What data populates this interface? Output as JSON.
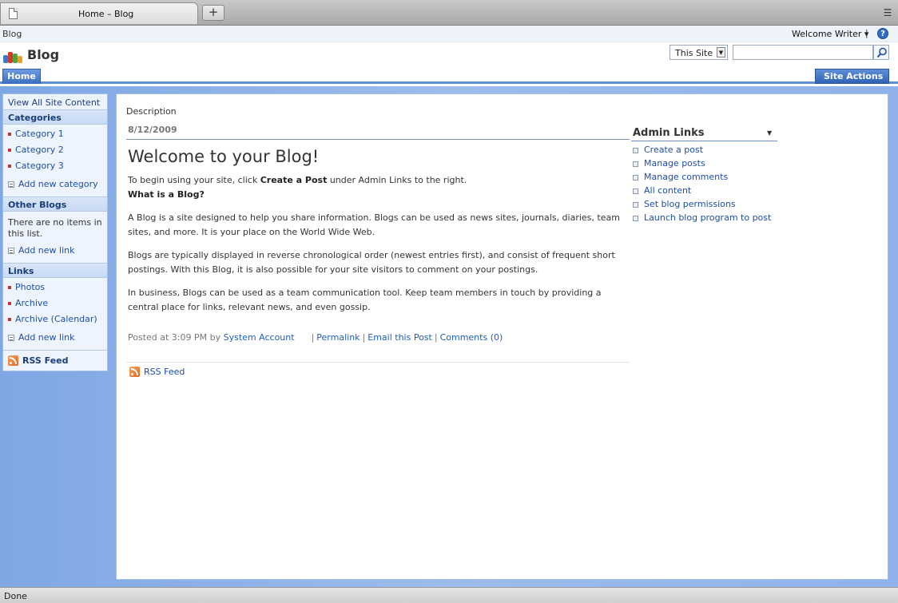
{
  "browser": {
    "tab_title": "Home – Blog",
    "new_tab": "+",
    "status": "Done"
  },
  "global": {
    "site_name": "Blog",
    "welcome": "Welcome Writer ▾",
    "welcome_sep": "|",
    "help": "?"
  },
  "header": {
    "title": "Blog",
    "scope_value": "This Site",
    "search_value": ""
  },
  "nav": {
    "home": "Home",
    "site_actions": "Site Actions ▾"
  },
  "leftnav": {
    "view_all": "View All Site Content",
    "categories_head": "Categories",
    "categories": [
      "Category 1",
      "Category 2",
      "Category 3"
    ],
    "add_category": "Add new category",
    "other_blogs_head": "Other Blogs",
    "other_blogs_empty": "There are no items in this list.",
    "add_link_1": "Add new link",
    "links_head": "Links",
    "links": [
      "Photos",
      "Archive",
      "Archive (Calendar)"
    ],
    "add_link_2": "Add new link",
    "rss": "RSS Feed"
  },
  "post": {
    "description_label": "Description",
    "date": "8/12/2009",
    "title": "Welcome to your Blog!",
    "intro_pre": "To begin using your site, click ",
    "intro_bold": "Create a Post",
    "intro_post": " under Admin Links to the right.",
    "what_is": "What is a Blog?",
    "p1": "A Blog is a site designed to help you share information. Blogs can be used as news sites, journals, diaries, team sites, and more. It is your place on the World Wide Web.",
    "p2": "Blogs are typically displayed in reverse chronological order (newest entries first), and consist of frequent short postings. With this Blog, it is also possible for your site visitors to comment on your postings.",
    "p3": "In business, Blogs can be used as a team communication tool. Keep team members in touch by providing a central place for links, relevant news, and even gossip.",
    "posted_at": "Posted at 3:09 PM by ",
    "author": "System Account",
    "permalink": "Permalink",
    "email": "Email this Post",
    "comments": "Comments (0)",
    "sep": "|",
    "rss": "RSS Feed"
  },
  "admin": {
    "title": "Admin Links",
    "items": [
      "Create a post",
      "Manage posts",
      "Manage comments",
      "All content",
      "Set blog permissions",
      "Launch blog program to post"
    ]
  }
}
